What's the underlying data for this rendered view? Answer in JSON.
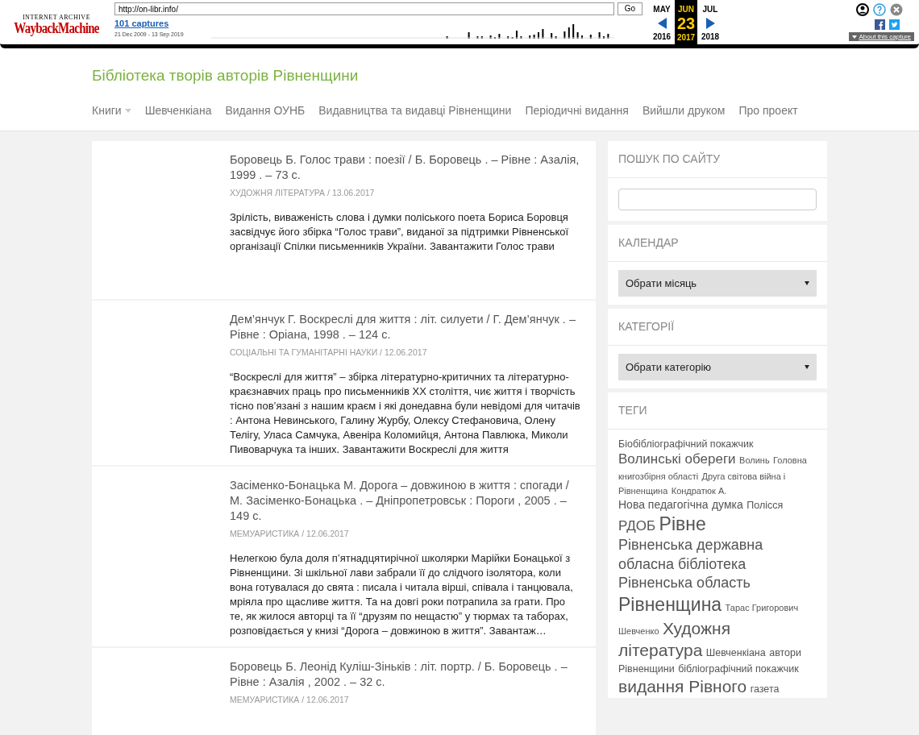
{
  "wayback": {
    "logo_top": "INTERNET ARCHIVE",
    "logo": "WaybackMachine",
    "url": "http://on-libr.info/",
    "go": "Go",
    "captures": "101 captures",
    "range": "21 Dec 2009 - 13 Sep 2019",
    "months": [
      {
        "label": "MAY",
        "selected": false
      },
      {
        "label": "JUN",
        "selected": true
      },
      {
        "label": "JUL",
        "selected": false
      }
    ],
    "day": "23",
    "years": [
      {
        "label": "2016",
        "selected": false
      },
      {
        "label": "2017",
        "selected": true
      },
      {
        "label": "2018",
        "selected": false
      }
    ],
    "about": "About this capture"
  },
  "site": {
    "title": "Бібліотека творів авторів Рівненщини",
    "nav": [
      {
        "label": "Книги",
        "dropdown": true
      },
      {
        "label": "Шевченкіана",
        "dropdown": false
      },
      {
        "label": "Видання ОУНБ",
        "dropdown": false
      },
      {
        "label": "Видавництва та видавці Рівненщини",
        "dropdown": false
      },
      {
        "label": "Періодичні видання",
        "dropdown": false
      },
      {
        "label": "Вийшли друком",
        "dropdown": false
      },
      {
        "label": "Про проект",
        "dropdown": false
      }
    ]
  },
  "posts": [
    {
      "title": "Боровець Б. Голос трави : поезії / Б. Боровець . – Рівне : Азалія, 1999 . – 73 с.",
      "meta": "ХУДОЖНЯ ЛІТЕРАТУРА / 13.06.2017",
      "excerpt": "Зрілість, виваженість слова і думки поліського поета Бориса Боровця засвідчує його збірка “Голос трави”, виданої за підтримки Рівненської організації Спілки письменників України. Завантажити Голос трави"
    },
    {
      "title": "Дем’янчук Г. Воскреслі для життя : літ. силуети / Г. Дем’янчук . – Рівне : Оріана, 1998 . – 124 с.",
      "meta": "СОЦІАЛЬНІ ТА ГУМАНІТАРНІ НАУКИ / 12.06.2017",
      "excerpt": "“Воскреслі для життя”  – збірка літературно-критичних та літературно-краєзнавчих праць про письменників ХХ століття, чиє життя і творчість тісно пов’язані з нашим краєм і які донедавна були невідомі для читачів : Антона Невинського, Галину Журбу, Олексу Стефановича, Олену Телігу, Уласа Самчука, Авеніра Коломийця, Антона Павлюка, Миколи Пивоварчука та інших. Завантажити Воскреслі для життя"
    },
    {
      "title": "Засіменко-Бонацька М. Дорога – довжиною в життя : спогади / М. Засіменко-Бонацька . – Дніпропетровськ : Пороги , 2005 . – 149 с.",
      "meta": "МЕМУАРИСТИКА / 12.06.2017",
      "excerpt": "Нелегкою була доля п’ятнадцятирічної школярки Марійки Бонацької з Рівненщини. Зі шкільної лави забрали її до слідчого ізолятора, коли вона готувалася до свята : писала і читала вірші, співала і танцювала, мріяла про щасливе життя. Та на довгі роки потрапила за грати. Про те, як жилося авторці та її “друзям по нещастю” у тюрмах та таборах, розповідається у книзі “Дорога – довжиною в життя”. Завантаж…"
    },
    {
      "title": "Боровець Б. Леонід Куліш-Зіньків : літ. портр. / Б. Боровець . – Рівне : Азалія , 2002 . – 32 с.",
      "meta": "МЕМУАРИСТИКА / 12.06.2017"
    }
  ],
  "sidebar": {
    "search_title": "ПОШУК ПО САЙТУ",
    "calendar_title": "КАЛЕНДАР",
    "month_select": "Обрати місяць",
    "categories_title": "КАТЕГОРІЇ",
    "category_select": "Обрати категорію",
    "tags_title": "ТЕГИ",
    "tags": [
      {
        "label": "Біобібліографічний покажчик",
        "kind": "s"
      },
      {
        "label": "Волинські обереги",
        "kind": "l"
      },
      {
        "label": "Волинь",
        "kind": "xs"
      },
      {
        "parts": [
          "Головна",
          "книгозбірня області"
        ],
        "kind": "xs"
      },
      {
        "parts": [
          "Друга світова війна і",
          "Рівненщина"
        ],
        "kind": "xs"
      },
      {
        "label": "Кондратюк А.",
        "kind": "xs"
      },
      {
        "parts": [
          "Нова педагогічна",
          "думка"
        ],
        "kind": "m"
      },
      {
        "label": "Полісся",
        "kind": "s"
      },
      {
        "label": "РДОБ",
        "kind": "l"
      },
      {
        "label": "Рівне",
        "kind": "xxl"
      },
      {
        "parts": [
          "Рівненська державна",
          "обласна бібліотека"
        ],
        "kind": "xl"
      },
      {
        "label": "Рівненська область",
        "kind": "xl"
      },
      {
        "label": "Рівненщина",
        "kind": "xxl"
      },
      {
        "parts": [
          "Тарас Григорович",
          "Шевченко"
        ],
        "kind": "xs"
      },
      {
        "parts": [
          "Художня",
          "література"
        ],
        "kind": "xl2"
      },
      {
        "label": "Шевченкіана",
        "kind": "s"
      },
      {
        "parts": [
          "автори",
          "Рівненщини"
        ],
        "kind": "s"
      },
      {
        "label": "бібліографічний покажчик",
        "kind": "s"
      },
      {
        "label": "видання Рівного",
        "kind": "xl2"
      },
      {
        "label": "газета",
        "kind": "s"
      }
    ]
  }
}
